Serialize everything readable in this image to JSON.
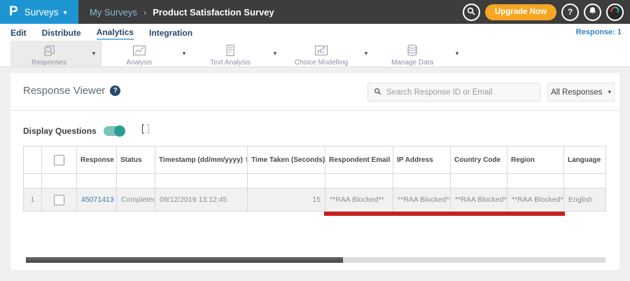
{
  "ui": {
    "caret_down": "▾",
    "sort_desc": "▼",
    "sort_both": "⇅",
    "breadcrumb_separator": "›",
    "question_mark": "?"
  },
  "topbar": {
    "logo_letter": "P",
    "product_menu": "Surveys",
    "breadcrumb": {
      "parent": "My Surveys",
      "current": "Product Satisfaction Survey"
    },
    "upgrade_label": "Upgrade Now"
  },
  "tabs": {
    "items": [
      "Edit",
      "Distribute",
      "Analytics",
      "Integration"
    ],
    "active": "Analytics",
    "response_count": "Response: 1"
  },
  "toolbar": {
    "items": [
      {
        "label": "Responses",
        "icon": "responses-icon",
        "active": true
      },
      {
        "label": "Analysis",
        "icon": "line-chart-icon",
        "active": false
      },
      {
        "label": "Text Analysis",
        "icon": "text-document-icon",
        "active": false
      },
      {
        "label": "Choice Modelling",
        "icon": "bar-chart-icon",
        "active": false
      },
      {
        "label": "Manage Data",
        "icon": "database-icon",
        "active": false
      }
    ]
  },
  "viewer": {
    "title": "Response Viewer",
    "search_placeholder": "Search Response ID or Email",
    "responses_filter": "All Responses",
    "display_questions_label": "Display Questions",
    "display_questions_on": true
  },
  "table": {
    "columns": {
      "response_id": "Response ID",
      "status": "Status",
      "timestamp": "Timestamp (dd/mm/yyyy)",
      "time_taken": "Time Taken (Seconds)",
      "respondent_email": "Respondent Email",
      "ip_address": "IP Address",
      "country_code": "Country Code",
      "region": "Region",
      "language": "Language"
    },
    "rows": [
      {
        "index": "1",
        "response_id": "45071413",
        "status": "Completed",
        "timestamp": "09/12/2019 13:12:45",
        "time_taken": "15",
        "respondent_email": "**RAA Blocked**",
        "ip_address": "**RAA Blocked**",
        "country_code": "**RAA Blocked**",
        "region": "**RAA Blocked**",
        "language": "English"
      }
    ]
  },
  "colors": {
    "brand_blue": "#1e95d3",
    "topbar_gray": "#3d3d3d",
    "upgrade_orange": "#f5a623",
    "toggle_teal": "#2a9d93",
    "link_blue": "#3b7bab",
    "annotation_red": "#c8201d"
  }
}
